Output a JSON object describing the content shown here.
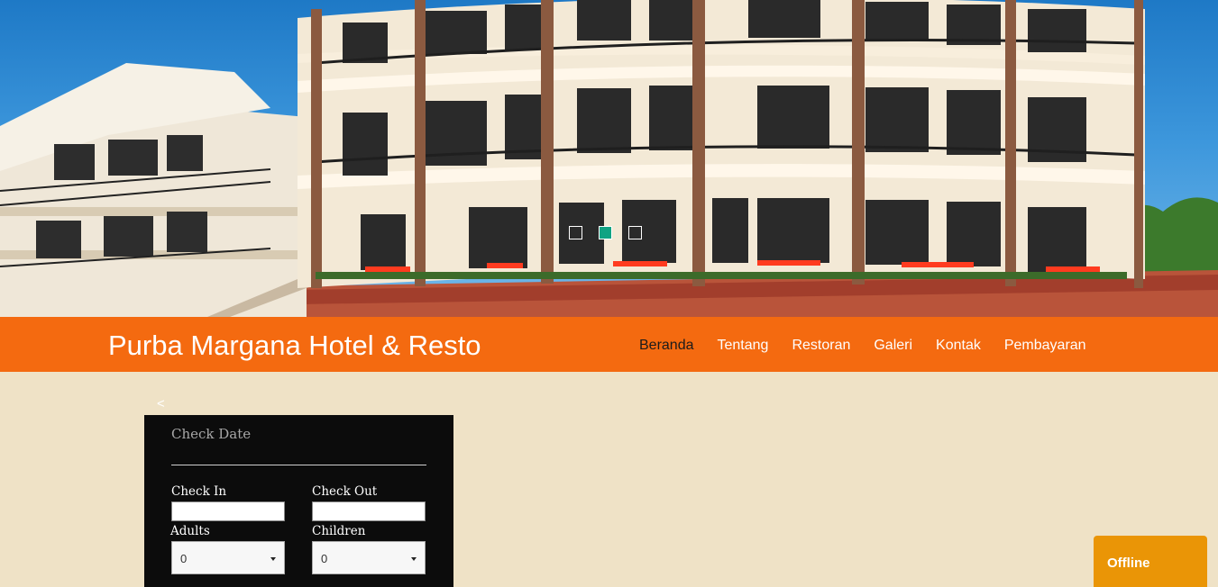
{
  "hero": {
    "image": "hotel-building-photo",
    "slider_dots": [
      {
        "active": false
      },
      {
        "active": true
      },
      {
        "active": false
      }
    ]
  },
  "nav": {
    "brand": "Purba Margana Hotel & Resto",
    "items": [
      {
        "label": "Beranda",
        "current": true
      },
      {
        "label": "Tentang",
        "current": false
      },
      {
        "label": "Restoran",
        "current": false
      },
      {
        "label": "Galeri",
        "current": false
      },
      {
        "label": "Kontak",
        "current": false
      },
      {
        "label": "Pembayaran",
        "current": false
      }
    ]
  },
  "booking": {
    "back_arrow": "<",
    "title": "Check Date",
    "check_in_label": "Check In",
    "check_in_value": "",
    "check_out_label": "Check Out",
    "check_out_value": "",
    "adults_label": "Adults",
    "adults_value": "0",
    "children_label": "Children",
    "children_value": "0"
  },
  "chat": {
    "status": "Offline"
  },
  "colors": {
    "nav_bg": "#f46a10",
    "page_bg": "#efe2c6",
    "slider_active": "#10a383",
    "chat_bg": "#ea9506",
    "booking_bg": "#0c0c0c"
  }
}
